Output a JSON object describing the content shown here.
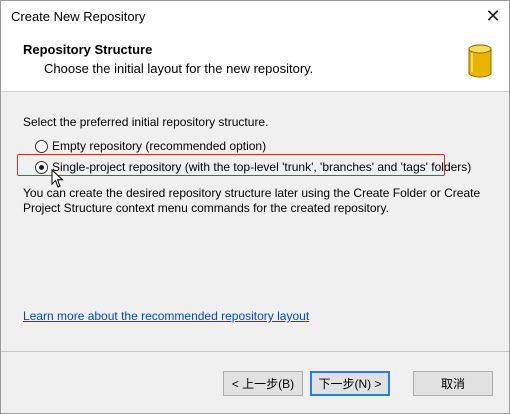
{
  "window": {
    "title": "Create New Repository",
    "close_glyph": "✕"
  },
  "header": {
    "title": "Repository Structure",
    "subtitle": "Choose the initial layout for the new repository.",
    "icon": "database-icon",
    "icon_color": "#e8b400"
  },
  "content": {
    "prompt": "Select the preferred initial repository structure.",
    "options": [
      {
        "label": "Empty repository (recommended option)",
        "selected": false
      },
      {
        "label": "Single-project repository (with the top-level 'trunk', 'branches' and 'tags' folders)",
        "selected": true
      }
    ],
    "description": "You can create the desired repository structure later using the Create Folder or Create Project Structure context menu commands for the created repository.",
    "link": "Learn more about the recommended repository layout"
  },
  "buttons": {
    "back": "< 上一步(B)",
    "next": "下一步(N) >",
    "cancel": "取消"
  },
  "colors": {
    "highlight": "#d03030",
    "link": "#0645c8",
    "default_button_border": "#2c7fd8"
  }
}
